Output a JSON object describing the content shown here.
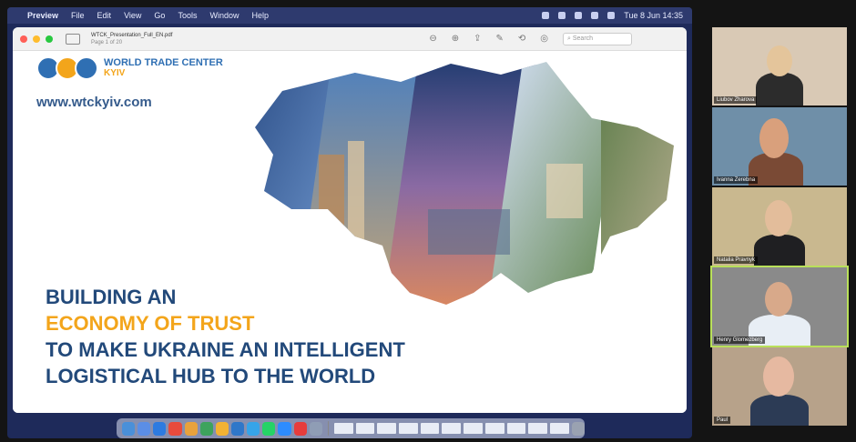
{
  "menubar": {
    "app": "Preview",
    "items": [
      "File",
      "Edit",
      "View",
      "Go",
      "Tools",
      "Window",
      "Help"
    ],
    "clock": "Tue 8 Jun  14:35"
  },
  "window": {
    "filename": "WTCK_Presentation_Full_EN.pdf",
    "page": "Page 1 of 20",
    "search_placeholder": "Search"
  },
  "slide": {
    "logo_line1": "WORLD TRADE CENTER",
    "logo_line2": "KYIV",
    "url": "www.wtckyiv.com",
    "headline": [
      "BUILDING AN",
      "ECONOMY OF TRUST",
      "TO MAKE UKRAINE AN INTELLIGENT",
      "LOGISTICAL HUB TO THE WORLD"
    ],
    "colors": {
      "blue": "#22497a",
      "orange": "#f3a51b"
    }
  },
  "participants": [
    {
      "name": "Liubov Zharova"
    },
    {
      "name": "Ivanna Zerebna"
    },
    {
      "name": "Natalia Pravnyk"
    },
    {
      "name": "Henry Glomezberg"
    },
    {
      "name": "Paul"
    }
  ]
}
